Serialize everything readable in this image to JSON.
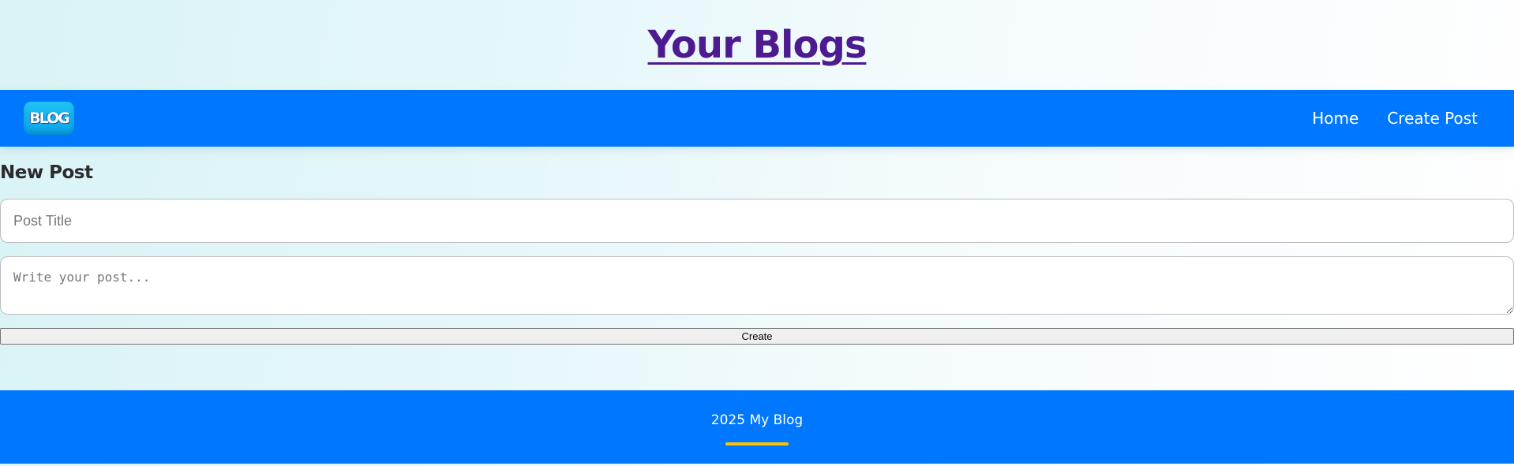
{
  "header": {
    "title": "Your Blogs"
  },
  "navbar": {
    "logo_text": "BLOG",
    "links": [
      {
        "label": "Home"
      },
      {
        "label": "Create Post"
      }
    ]
  },
  "new_post_form": {
    "heading": "New Post",
    "title_field": {
      "value": "",
      "placeholder": "Post Title"
    },
    "body_field": {
      "value": "",
      "placeholder": "Write your post..."
    },
    "submit_label": "Create"
  },
  "footer": {
    "text": "2025 My Blog"
  },
  "colors": {
    "primary_blue": "#0077ff",
    "title_purple": "#4d1b8f",
    "footer_accent": "#ffc107"
  }
}
